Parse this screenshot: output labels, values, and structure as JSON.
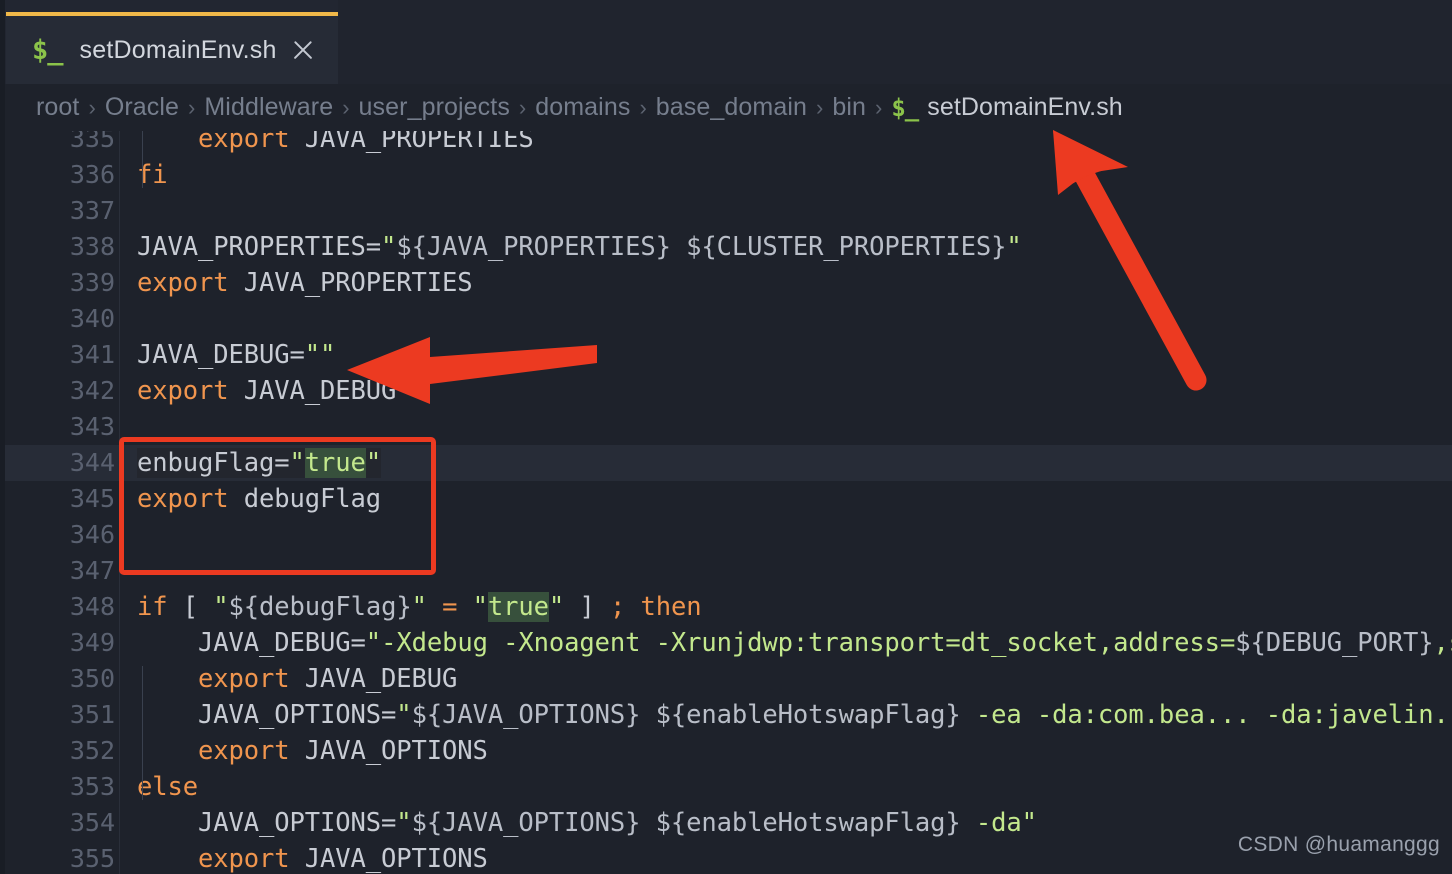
{
  "window": {
    "tab": {
      "icon": "shell-prompt-icon",
      "icon_glyph": "$_",
      "title": "setDomainEnv.sh",
      "close_label": "×",
      "accent_color": "#f0b849"
    }
  },
  "breadcrumb": {
    "items": [
      "root",
      "Oracle",
      "Middleware",
      "user_projects",
      "domains",
      "base_domain",
      "bin"
    ],
    "separator": "›",
    "file_icon_glyph": "$_",
    "file": "setDomainEnv.sh"
  },
  "editor": {
    "language": "shell",
    "current_line": 344,
    "search_match": "true",
    "lines": [
      {
        "n": "335",
        "indent": 1,
        "segments": [
          {
            "t": "    ",
            "c": "plain"
          },
          {
            "t": "export",
            "c": "kw"
          },
          {
            "t": " JAVA_PROPERTIES",
            "c": "plain"
          }
        ]
      },
      {
        "n": "336",
        "indent": 0,
        "segments": [
          {
            "t": "fi",
            "c": "kw"
          }
        ]
      },
      {
        "n": "337",
        "indent": 0,
        "segments": [
          {
            "t": "",
            "c": "plain"
          }
        ]
      },
      {
        "n": "338",
        "indent": 0,
        "segments": [
          {
            "t": "JAVA_PROPERTIES=",
            "c": "plain"
          },
          {
            "t": "\"",
            "c": "str"
          },
          {
            "t": "${JAVA_PROPERTIES} ${CLUSTER_PROPERTIES}",
            "c": "var"
          },
          {
            "t": "\"",
            "c": "str"
          }
        ]
      },
      {
        "n": "339",
        "indent": 0,
        "segments": [
          {
            "t": "export",
            "c": "kw"
          },
          {
            "t": " JAVA_PROPERTIES",
            "c": "plain"
          }
        ]
      },
      {
        "n": "340",
        "indent": 0,
        "segments": [
          {
            "t": "",
            "c": "plain"
          }
        ]
      },
      {
        "n": "341",
        "indent": 0,
        "segments": [
          {
            "t": "JAVA_DEBUG=",
            "c": "plain"
          },
          {
            "t": "\"\"",
            "c": "str"
          }
        ]
      },
      {
        "n": "342",
        "indent": 0,
        "segments": [
          {
            "t": "export",
            "c": "kw"
          },
          {
            "t": " JAVA_DEBUG",
            "c": "plain"
          }
        ]
      },
      {
        "n": "343",
        "indent": 0,
        "segments": [
          {
            "t": "",
            "c": "plain"
          }
        ]
      },
      {
        "n": "344",
        "indent": 0,
        "current": true,
        "segments": [
          {
            "t": "enbugFlag=",
            "c": "plain sel"
          },
          {
            "t": "\"",
            "c": "str sel"
          },
          {
            "t": "true",
            "c": "str hit"
          },
          {
            "t": "\"",
            "c": "str sel"
          }
        ]
      },
      {
        "n": "345",
        "indent": 0,
        "segments": [
          {
            "t": "export",
            "c": "kw"
          },
          {
            "t": " debugFlag",
            "c": "plain"
          }
        ]
      },
      {
        "n": "346",
        "indent": 0,
        "segments": [
          {
            "t": "",
            "c": "plain"
          }
        ]
      },
      {
        "n": "347",
        "indent": 0,
        "segments": [
          {
            "t": "",
            "c": "plain"
          }
        ]
      },
      {
        "n": "348",
        "indent": 0,
        "segments": [
          {
            "t": "if",
            "c": "kw"
          },
          {
            "t": " [ ",
            "c": "plain"
          },
          {
            "t": "\"",
            "c": "str"
          },
          {
            "t": "${debugFlag}",
            "c": "var"
          },
          {
            "t": "\"",
            "c": "str"
          },
          {
            "t": " ",
            "c": "plain"
          },
          {
            "t": "=",
            "c": "kw"
          },
          {
            "t": " ",
            "c": "plain"
          },
          {
            "t": "\"",
            "c": "str"
          },
          {
            "t": "true",
            "c": "str hit"
          },
          {
            "t": "\"",
            "c": "str"
          },
          {
            "t": " ] ",
            "c": "plain"
          },
          {
            "t": ";",
            "c": "kw"
          },
          {
            "t": " ",
            "c": "plain"
          },
          {
            "t": "then",
            "c": "kw"
          }
        ]
      },
      {
        "n": "349",
        "indent": 1,
        "segments": [
          {
            "t": "    JAVA_DEBUG=",
            "c": "plain"
          },
          {
            "t": "\"",
            "c": "str"
          },
          {
            "t": "-Xdebug -Xnoagent -Xrunjdwp:transport=dt_socket,address=",
            "c": "str"
          },
          {
            "t": "${DEBUG_PORT}",
            "c": "var"
          },
          {
            "t": ",serve",
            "c": "str"
          }
        ]
      },
      {
        "n": "350",
        "indent": 1,
        "segments": [
          {
            "t": "    ",
            "c": "plain"
          },
          {
            "t": "export",
            "c": "kw"
          },
          {
            "t": " JAVA_DEBUG",
            "c": "plain"
          }
        ]
      },
      {
        "n": "351",
        "indent": 1,
        "segments": [
          {
            "t": "    JAVA_OPTIONS=",
            "c": "plain"
          },
          {
            "t": "\"",
            "c": "str"
          },
          {
            "t": "${JAVA_OPTIONS} ${enableHotswapFlag}",
            "c": "var"
          },
          {
            "t": " -ea -da:com.bea... -da:javelin... -d",
            "c": "str"
          }
        ]
      },
      {
        "n": "352",
        "indent": 1,
        "segments": [
          {
            "t": "    ",
            "c": "plain"
          },
          {
            "t": "export",
            "c": "kw"
          },
          {
            "t": " JAVA_OPTIONS",
            "c": "plain"
          }
        ]
      },
      {
        "n": "353",
        "indent": 0,
        "segments": [
          {
            "t": "else",
            "c": "kw"
          }
        ]
      },
      {
        "n": "354",
        "indent": 1,
        "segments": [
          {
            "t": "    JAVA_OPTIONS=",
            "c": "plain"
          },
          {
            "t": "\"",
            "c": "str"
          },
          {
            "t": "${JAVA_OPTIONS} ${enableHotswapFlag}",
            "c": "var"
          },
          {
            "t": " -da",
            "c": "str"
          },
          {
            "t": "\"",
            "c": "str"
          }
        ]
      },
      {
        "n": "355",
        "indent": 1,
        "segments": [
          {
            "t": "    ",
            "c": "plain"
          },
          {
            "t": "export",
            "c": "kw"
          },
          {
            "t": " JAVA_OPTIONS",
            "c": "plain"
          }
        ]
      }
    ]
  },
  "annotations": {
    "color": "#ec3a21",
    "highlight_box": {
      "lines": "344-345"
    },
    "arrow_left": {
      "points_at_line": "341"
    },
    "arrow_up": {
      "points_at": "breadcrumb-file"
    }
  },
  "watermark": "CSDN @huamanggg",
  "colors": {
    "background": "#1e222b",
    "tab_bar": "#222631",
    "tab_active": "#262b36",
    "tab_accent": "#f0b849",
    "keyword": "#f0954e",
    "string": "#c3e88d",
    "variable": "#b9bec8",
    "text": "#c8ccd4",
    "line_number": "#5a6170",
    "annotation": "#ec3a21"
  }
}
